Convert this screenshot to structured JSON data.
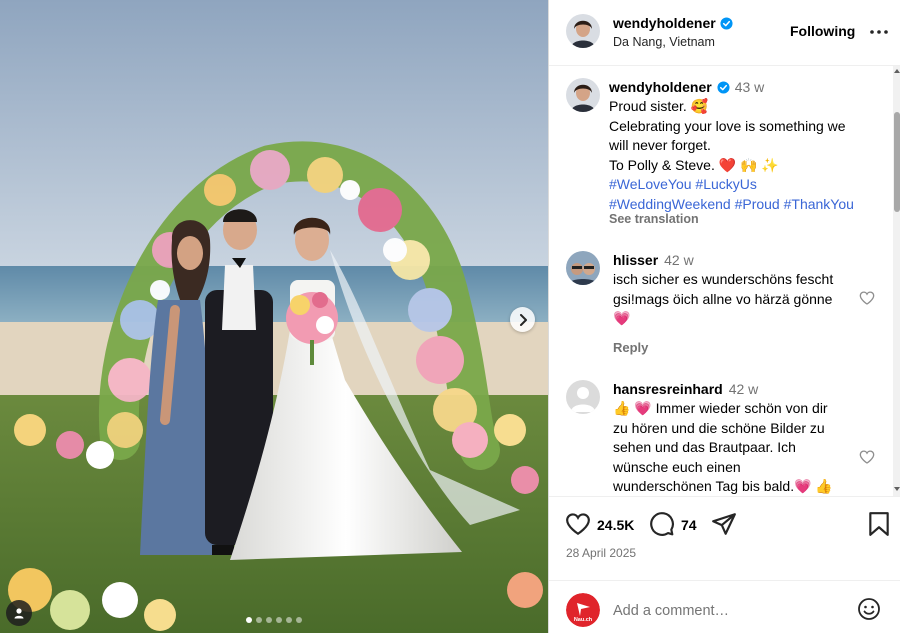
{
  "post": {
    "username": "wendyholdener",
    "location": "Da Nang, Vietnam",
    "follow_label": "Following",
    "photo_count": 6,
    "active_photo": 1
  },
  "caption": {
    "username": "wendyholdener",
    "time": "43 w",
    "lines": [
      "Proud sister. 🥰",
      "Celebrating your love is something we",
      "will never forget.",
      "To Polly & Steve. ❤️ 🙌 ✨"
    ],
    "hashtag_lines": [
      "#WeLoveYou #LuckyUs",
      "#WeddingWeekend #Proud #ThankYou"
    ],
    "see_translation": "See translation"
  },
  "comments": [
    {
      "username": "hlisser",
      "time": "42 w",
      "lines": [
        "isch sicher es wunderschöns fescht",
        "gsi!mags öich allne vo härzä gönne",
        "💗"
      ],
      "reply_label": "Reply"
    },
    {
      "username": "hansresreinhard",
      "time": "42 w",
      "lines": [
        "👍 💗 Immer wieder schön von dir",
        "zu hören und die schöne Bilder zu",
        "sehen und das Brautpaar. Ich",
        "wünsche euch einen",
        "wunderschönen Tag bis bald.💗 👍"
      ]
    }
  ],
  "actions": {
    "likes": "24.5K",
    "comments": "74",
    "date": "28 April 2025"
  },
  "add_comment": {
    "placeholder": "Add a comment…",
    "avatar_text": "Nau.ch"
  },
  "colors": {
    "verified": "#0095f6",
    "hashtag": "#3a66d6",
    "nau_red": "#e0242b"
  }
}
